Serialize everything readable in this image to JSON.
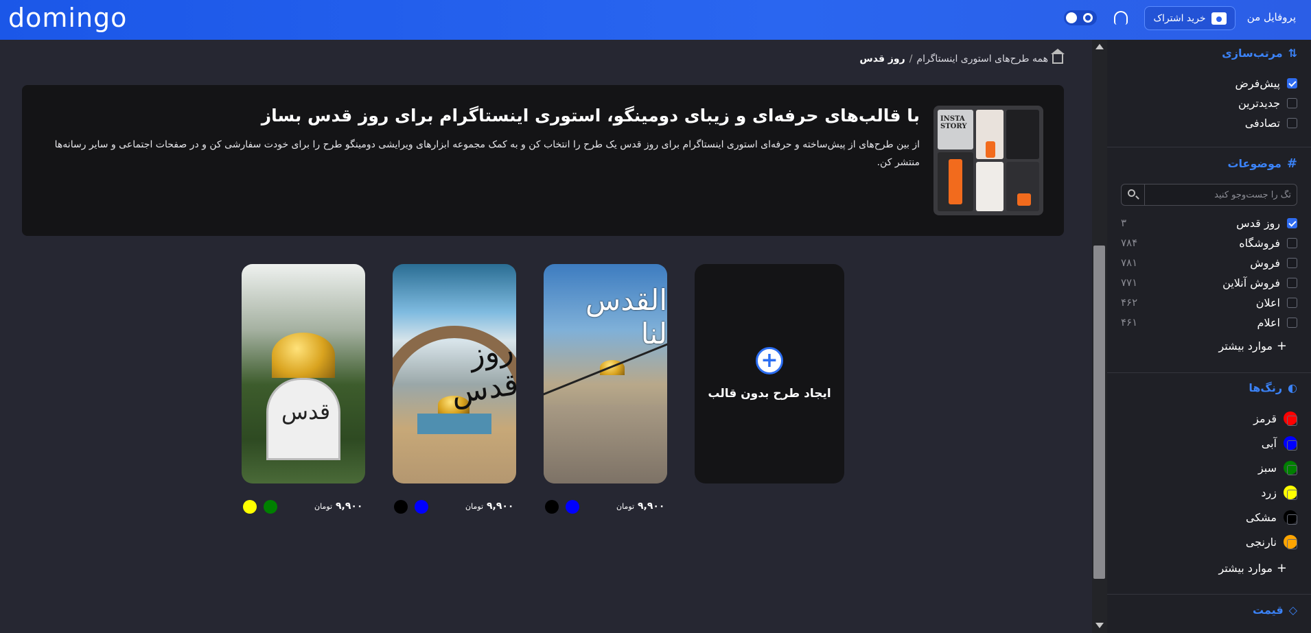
{
  "header": {
    "logo": "domingo",
    "profile_label": "پروفایل من",
    "subscribe_label": "خرید اشتراک"
  },
  "breadcrumb": {
    "parent": "همه طرح‌های استوری اینستاگرام",
    "current": "روز قدس"
  },
  "banner": {
    "title": "با قالب‌های حرفه‌ای و زیبای دومینگو، استوری اینستاگرام برای روز قدس بساز",
    "description": "از بین طرح‌های از پیش‌ساخته و حرفه‌ای استوری اینستاگرام برای روز قدس یک طرح را انتخاب کن و به کمک مجموعه ابزارهای ویرایشی دومینگو طرح را برای خودت سفارشی کن و در صفحات اجتماعی و سایر رسانه‌ها منتشر کن.",
    "thumb_text": "INSTA STORY"
  },
  "create_card": {
    "label": "ایجاد طرح بدون قالب"
  },
  "templates": [
    {
      "price": "۹,۹۰۰",
      "currency": "تومان",
      "swatches": [
        "#0000ff",
        "#000000"
      ],
      "calligraphy": "القدس لنا"
    },
    {
      "price": "۹,۹۰۰",
      "currency": "تومان",
      "swatches": [
        "#0000ff",
        "#000000"
      ],
      "calligraphy": "روز قدس"
    },
    {
      "price": "۹,۹۰۰",
      "currency": "تومان",
      "swatches": [
        "#008000",
        "#ffff00"
      ],
      "calligraphy": "قدس"
    }
  ],
  "sidebar": {
    "sort": {
      "title": "مرتب‌سازی",
      "options": [
        {
          "label": "پیش‌فرض",
          "checked": true
        },
        {
          "label": "جدیدترین",
          "checked": false
        },
        {
          "label": "تصادفی",
          "checked": false
        }
      ]
    },
    "topics": {
      "title": "موضوعات",
      "search_placeholder": "تگ را جست‌وجو کنید",
      "items": [
        {
          "label": "روز قدس",
          "count": "۳",
          "checked": true
        },
        {
          "label": "فروشگاه",
          "count": "۷۸۴",
          "checked": false
        },
        {
          "label": "فروش",
          "count": "۷۸۱",
          "checked": false
        },
        {
          "label": "فروش آنلاین",
          "count": "۷۷۱",
          "checked": false
        },
        {
          "label": "اعلان",
          "count": "۴۶۲",
          "checked": false
        },
        {
          "label": "اعلام",
          "count": "۴۶۱",
          "checked": false
        }
      ],
      "more_label": "موارد بیشتر"
    },
    "colors": {
      "title": "رنگ‌ها",
      "items": [
        {
          "label": "قرمز",
          "color": "#ff0000"
        },
        {
          "label": "آبی",
          "color": "#0000ff"
        },
        {
          "label": "سبز",
          "color": "#008000"
        },
        {
          "label": "زرد",
          "color": "#ffff00"
        },
        {
          "label": "مشکی",
          "color": "#000000"
        },
        {
          "label": "نارنجی",
          "color": "#ffa500"
        }
      ],
      "more_label": "موارد بیشتر"
    },
    "price": {
      "title": "قیمت"
    }
  }
}
